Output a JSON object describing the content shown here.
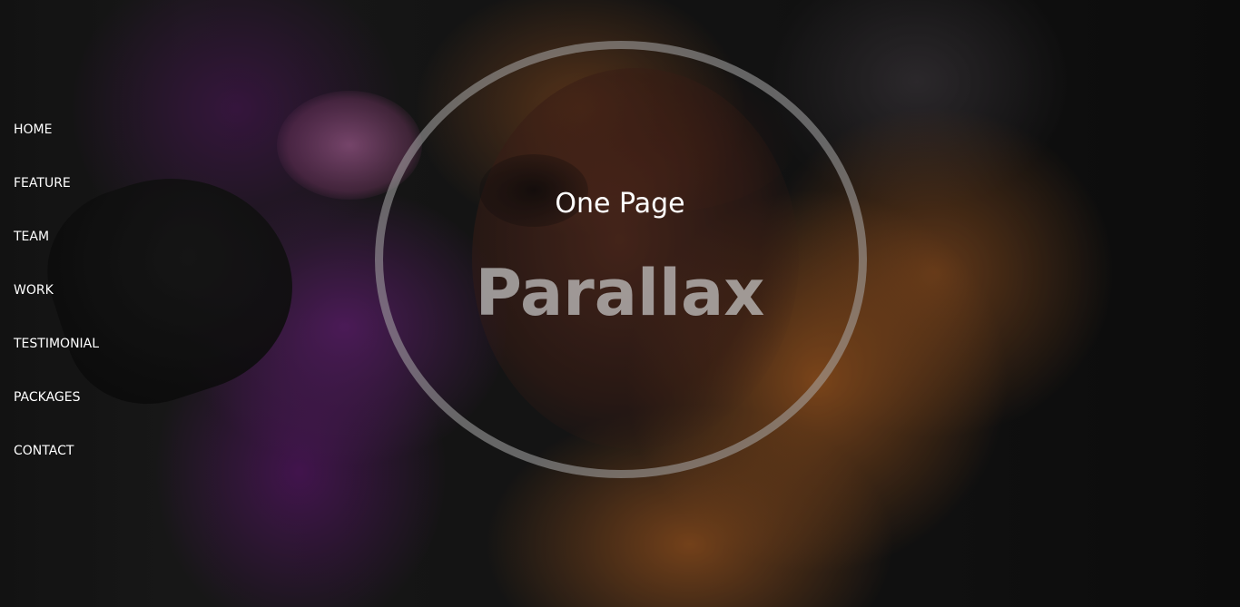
{
  "nav": {
    "items": [
      {
        "label": "HOME"
      },
      {
        "label": "FEATURE"
      },
      {
        "label": "TEAM"
      },
      {
        "label": "WORK"
      },
      {
        "label": "TESTIMONIAL"
      },
      {
        "label": "PACKAGES"
      },
      {
        "label": "CONTACT"
      }
    ]
  },
  "hero": {
    "subtitle": "One Page",
    "title": "Parallax"
  },
  "colors": {
    "nav_text": "#ffffff",
    "ring": "#aaaaaa",
    "title": "#c8c8c8",
    "smoke_purple": "#782c8c",
    "smoke_orange": "#c86e28"
  }
}
